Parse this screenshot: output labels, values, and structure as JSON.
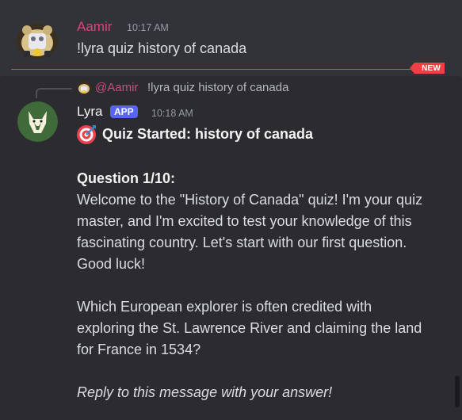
{
  "messages": {
    "first": {
      "author": "Aamir",
      "timestamp": "10:17 AM",
      "text": "!lyra quiz history of canada",
      "author_color": "#e0437b"
    },
    "divider": {
      "label": "NEW",
      "color": "#f23f43"
    },
    "second": {
      "reply": {
        "author": "@Aamir",
        "text": "!lyra quiz history of canada"
      },
      "author": "Lyra",
      "badge": "APP",
      "timestamp": "10:18 AM",
      "title": "Quiz Started: history of canada",
      "title_icon": "target-icon",
      "question_heading": "Question 1/10:",
      "intro": "Welcome to the \"History of Canada\" quiz! I'm your quiz master, and I'm excited to test your knowledge of this fascinating country. Let's start with our first question. Good luck!",
      "question": "Which European explorer is often credited with exploring the St. Lawrence River and claiming the land for France in 1534?",
      "footer": "Reply to this message with your answer!"
    }
  },
  "colors": {
    "background": "#313338",
    "highlight": "#2b2b30",
    "app_badge": "#5865f2"
  }
}
